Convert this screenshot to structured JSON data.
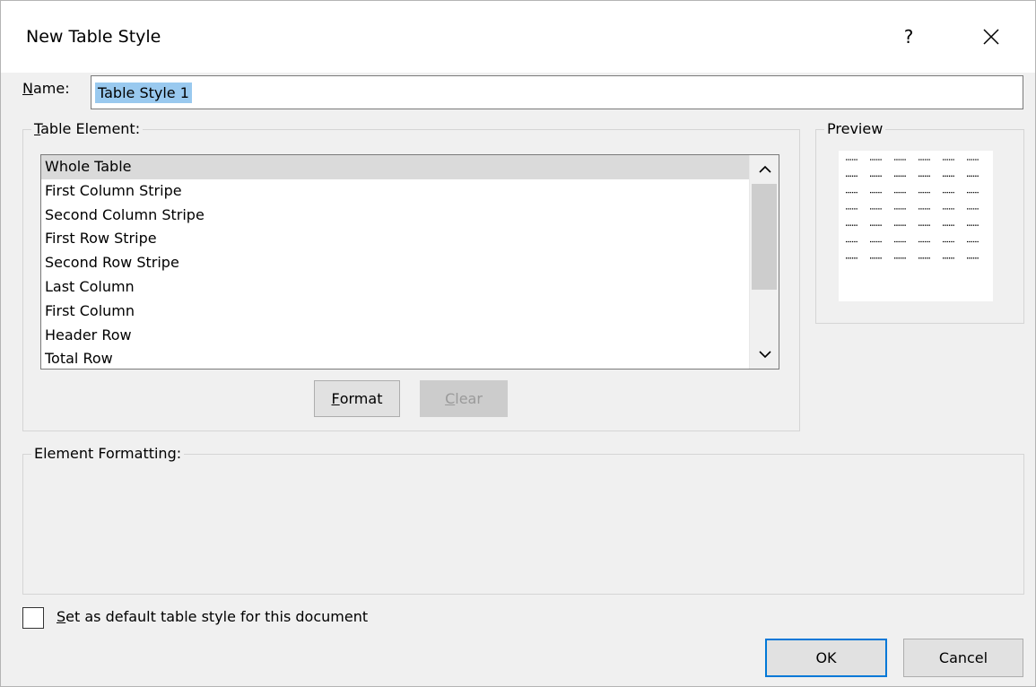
{
  "dialog": {
    "title": "New Table Style",
    "help_label": "?",
    "close_icon": "close-icon"
  },
  "name": {
    "label_prefix": "N",
    "label_rest": "ame:",
    "value": "Table Style 1"
  },
  "table_element": {
    "label_prefix": "T",
    "label_rest": "able Element:",
    "items": [
      "Whole Table",
      "First Column Stripe",
      "Second Column Stripe",
      "First Row Stripe",
      "Second Row Stripe",
      "Last Column",
      "First Column",
      "Header Row",
      "Total Row"
    ],
    "selected": "Whole Table",
    "scroll_up_icon": "chevron-up-icon",
    "scroll_down_icon": "chevron-down-icon"
  },
  "buttons": {
    "format_prefix": "F",
    "format_rest": "ormat",
    "clear_prefix": "C",
    "clear_rest": "lear",
    "ok": "OK",
    "cancel": "Cancel"
  },
  "preview": {
    "label": "Preview",
    "rows": 7,
    "cols": 6
  },
  "element_formatting": {
    "label": "Element Formatting:"
  },
  "default_checkbox": {
    "label_prefix": "S",
    "label_rest": "et as default table style for this document",
    "checked": false
  },
  "colors": {
    "selection": "#99c9ef",
    "accent": "#0078d7",
    "list_selected": "#dadada"
  }
}
